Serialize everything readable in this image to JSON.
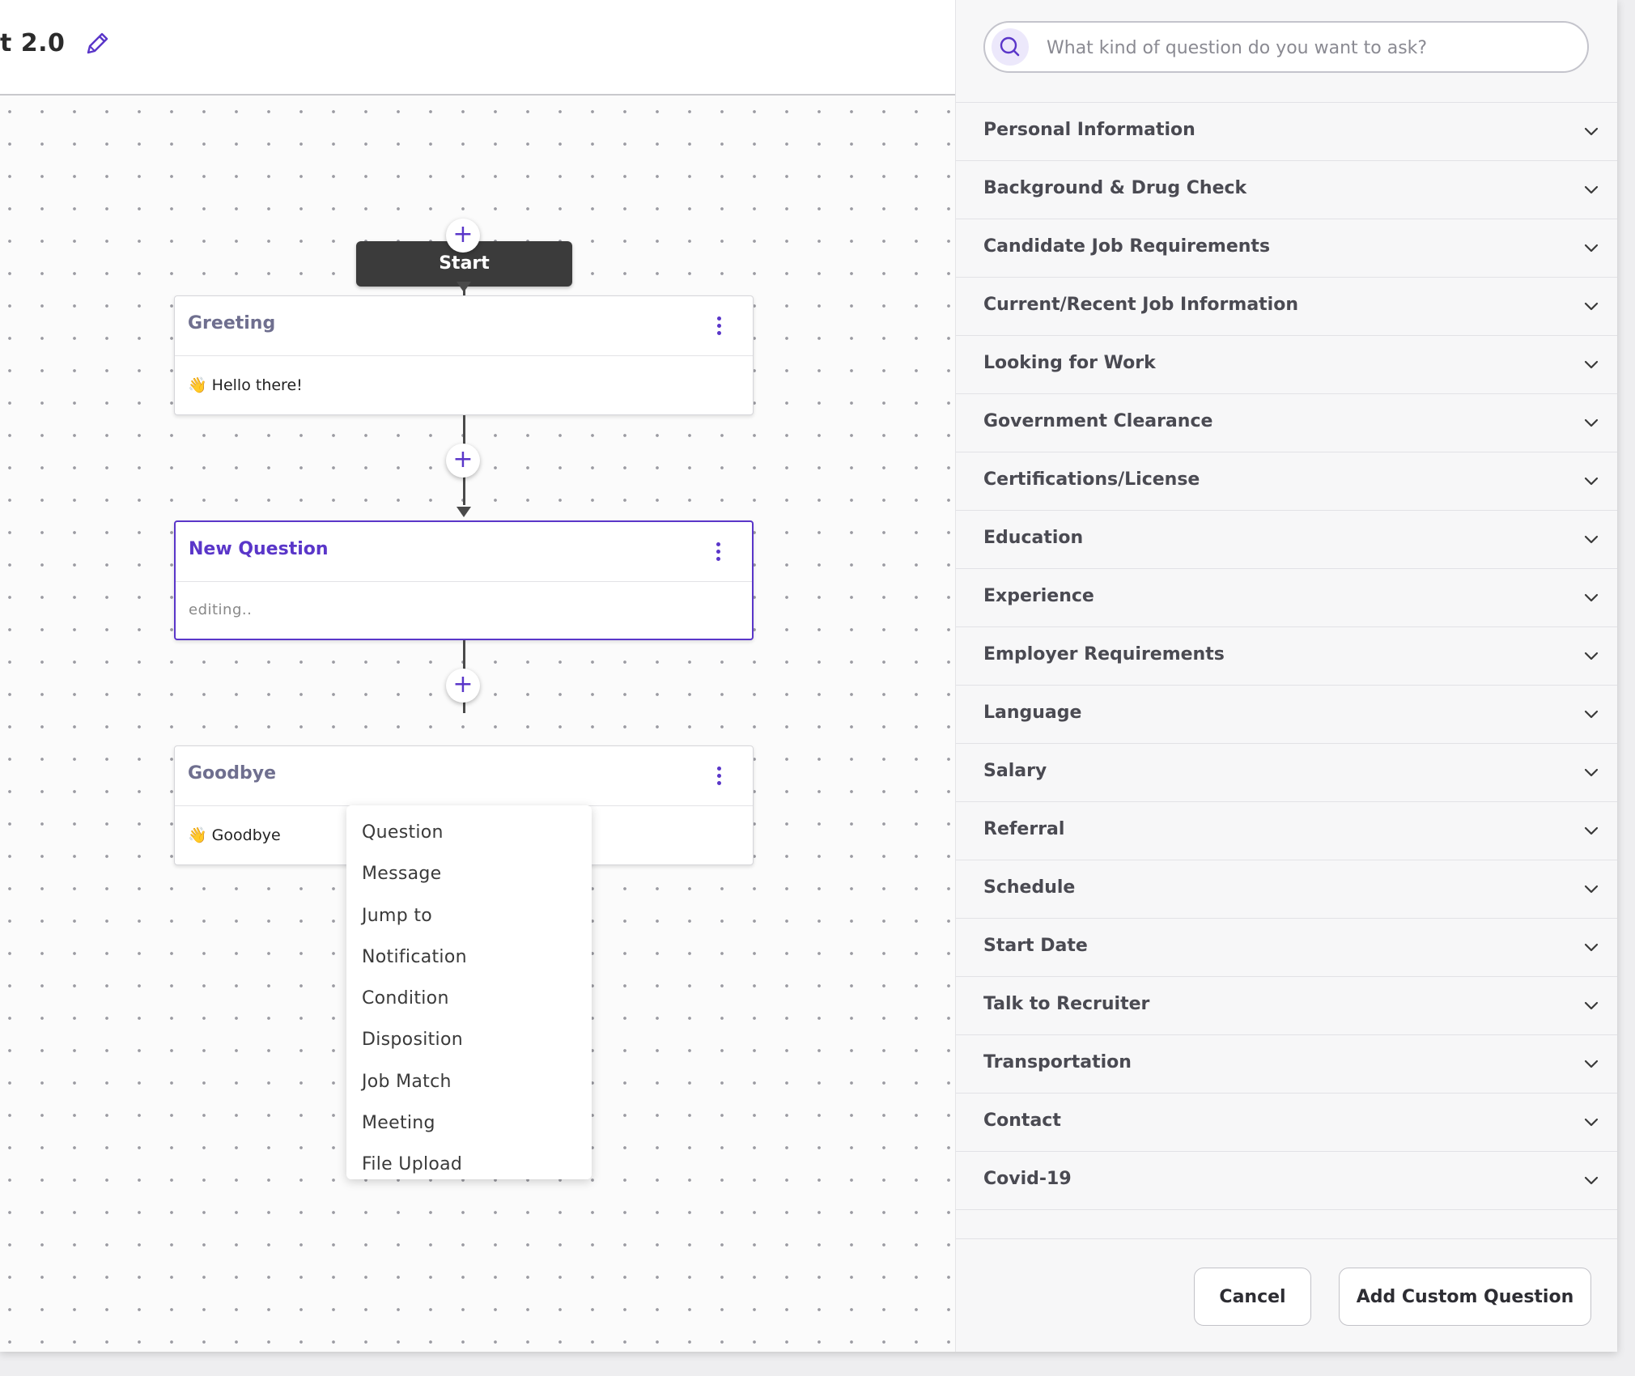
{
  "header": {
    "flow_title": "t 2.0"
  },
  "canvas": {
    "start_label": "Start",
    "nodes": [
      {
        "title": "Greeting",
        "body": "Hello there!",
        "emoji": "👋"
      },
      {
        "title": "New Question",
        "body": "editing..",
        "emoji": ""
      },
      {
        "title": "Goodbye",
        "body": "Goodbye",
        "emoji": "👋"
      }
    ],
    "add_step_symbol": "+"
  },
  "step_menu": {
    "items": [
      "Question",
      "Message",
      "Jump to",
      "Notification",
      "Condition",
      "Disposition",
      "Job Match",
      "Meeting",
      "File Upload"
    ]
  },
  "panel": {
    "search": {
      "placeholder": "What kind of question do you want to ask?",
      "value": ""
    },
    "categories": [
      "Personal Information",
      "Background & Drug Check",
      "Candidate Job Requirements",
      "Current/Recent Job Information",
      "Looking for Work",
      "Government Clearance",
      "Certifications/License",
      "Education",
      "Experience",
      "Employer Requirements",
      "Language",
      "Salary",
      "Referral",
      "Schedule",
      "Start Date",
      "Talk to Recruiter",
      "Transportation",
      "Contact",
      "Covid-19"
    ],
    "footer": {
      "cancel_label": "Cancel",
      "add_custom_label": "Add Custom Question"
    }
  },
  "colors": {
    "accent": "#5a36c9",
    "start_node": "#3b3b3b",
    "panel_bg": "#f7f7f8"
  },
  "icons": {
    "edit": "pencil-icon",
    "search": "search-icon",
    "node_menu": "vertical-dots-icon",
    "category_toggle": "chevron-down-icon",
    "emoji": "waving-hand"
  }
}
